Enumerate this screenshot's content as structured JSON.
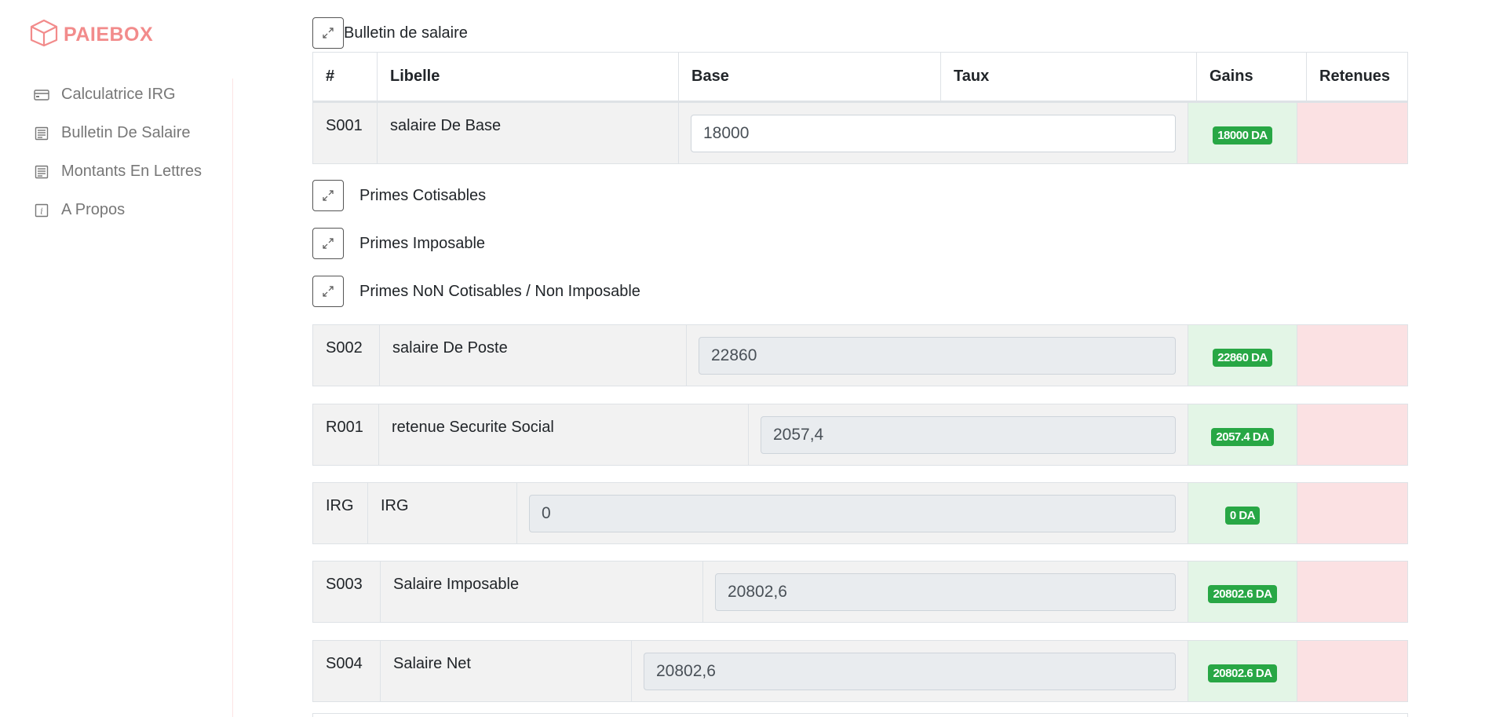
{
  "brand": {
    "name": "PAIEBOX",
    "color": "#f28b8b"
  },
  "sidebar": {
    "items": [
      {
        "label": "Calculatrice IRG",
        "icon": "credit-card-icon"
      },
      {
        "label": "Bulletin De Salaire",
        "icon": "document-icon"
      },
      {
        "label": "Montants En Lettres",
        "icon": "document-icon"
      },
      {
        "label": "A Propos",
        "icon": "info-icon"
      }
    ]
  },
  "main": {
    "title": "Bulletin de salaire",
    "columns": [
      "#",
      "Libelle",
      "Base",
      "Taux",
      "Gains",
      "Retenues"
    ],
    "base_row": {
      "code": "S001",
      "label": "salaire De Base",
      "value": "18000",
      "gain": "18000 DA"
    },
    "sections": [
      "Primes Cotisables",
      "Primes Imposable",
      "Primes NoN Cotisables / Non Imposable"
    ],
    "rows": [
      {
        "code": "S002",
        "label": "salaire De Poste",
        "value": "22860",
        "gain": "22860 DA"
      },
      {
        "code": "R001",
        "label": "retenue Securite Social",
        "value": "2057,4",
        "gain": "2057.4 DA"
      },
      {
        "code": "IRG",
        "label": "IRG",
        "value": "0",
        "gain": "0 DA"
      },
      {
        "code": "S003",
        "label": "Salaire Imposable",
        "value": "20802,6",
        "gain": "20802.6 DA"
      },
      {
        "code": "S004",
        "label": "Salaire Net",
        "value": "20802,6",
        "gain": "20802.6 DA"
      }
    ]
  },
  "colors": {
    "gains_bg": "#e3f5e6",
    "retenues_bg": "#fbe1e3",
    "badge": "#28a745"
  }
}
